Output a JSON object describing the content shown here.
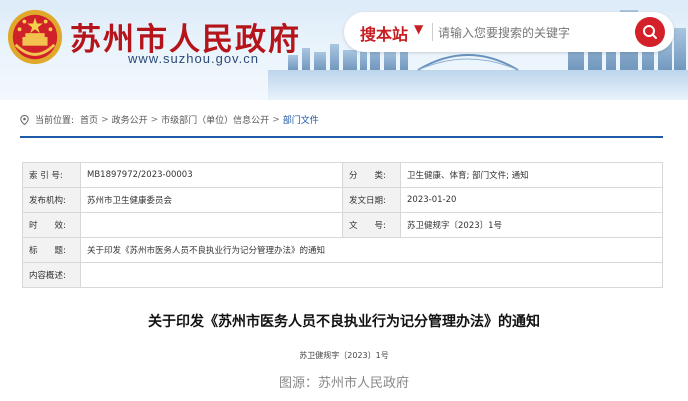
{
  "header": {
    "site_title": "苏州市人民政府",
    "site_url": "www.suzhou.gov.cn",
    "search": {
      "scope_label": "搜本站",
      "placeholder": "请输入您要搜索的关键字"
    }
  },
  "breadcrumb": {
    "prefix": "当前位置:",
    "items": [
      "首页",
      "政务公开",
      "市级部门（单位）信息公开",
      "部门文件"
    ],
    "separator": ">"
  },
  "info_table": {
    "rows": [
      {
        "l1": "索 引 号:",
        "v1": "MB1897972/2023-00003",
        "l2": "分　　类:",
        "v2": "卫生健康、体育;  部门文件;  通知"
      },
      {
        "l1": "发布机构:",
        "v1": "苏州市卫生健康委员会",
        "l2": "发文日期:",
        "v2": "2023-01-20"
      },
      {
        "l1": "时　　效:",
        "v1": "",
        "l2": "文　　号:",
        "v2": "苏卫健规字〔2023〕1号"
      }
    ],
    "title_label": "标　　题:",
    "title_value": "关于印发《苏州市医务人员不良执业行为记分管理办法》的通知",
    "summary_label": "内容概述:",
    "summary_value": ""
  },
  "document": {
    "title": "关于印发《苏州市医务人员不良执业行为记分管理办法》的通知",
    "number": "苏卫健规字〔2023〕1号"
  },
  "caption": "图源：苏州市人民政府",
  "colors": {
    "brand_red": "#b5141a",
    "link_blue": "#1a56a8",
    "rule_blue": "#1e5aa8"
  },
  "icons": {
    "emblem": "national-emblem-icon",
    "search_button": "search-icon",
    "location": "location-pin-icon"
  }
}
